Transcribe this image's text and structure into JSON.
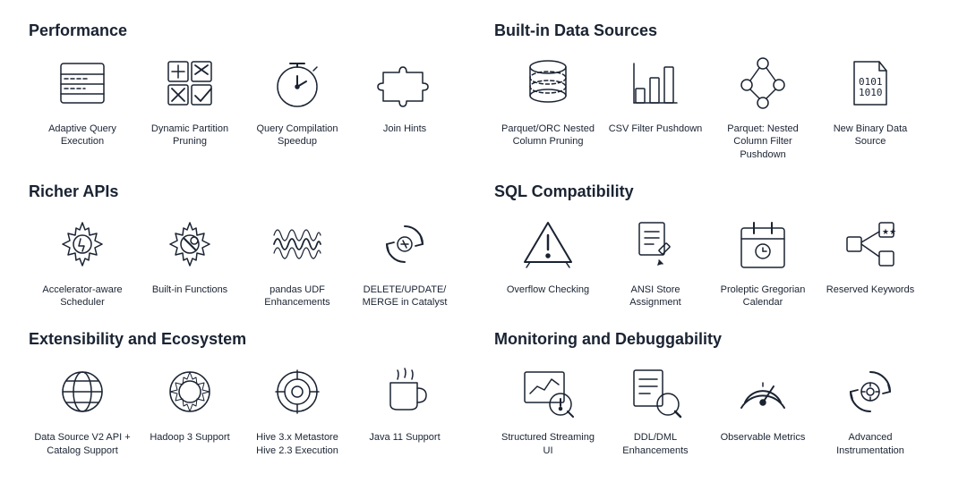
{
  "sections": [
    {
      "id": "performance",
      "title": "Performance",
      "items": [
        {
          "id": "adaptive-query",
          "label": "Adaptive Query Execution",
          "icon": "adaptive-query"
        },
        {
          "id": "dynamic-partition",
          "label": "Dynamic Partition Pruning",
          "icon": "dynamic-partition"
        },
        {
          "id": "query-compilation",
          "label": "Query Compilation Speedup",
          "icon": "query-compilation"
        },
        {
          "id": "join-hints",
          "label": "Join Hints",
          "icon": "join-hints"
        }
      ]
    },
    {
      "id": "built-in-sources",
      "title": "Built-in Data Sources",
      "items": [
        {
          "id": "parquet-orc-nested",
          "label": "Parquet/ORC Nested Column Pruning",
          "icon": "parquet-orc"
        },
        {
          "id": "csv-filter",
          "label": "CSV Filter Pushdown",
          "icon": "csv-filter"
        },
        {
          "id": "parquet-nested-filter",
          "label": "Parquet: Nested Column Filter Pushdown",
          "icon": "parquet-nested-filter"
        },
        {
          "id": "new-binary",
          "label": "New Binary Data Source",
          "icon": "new-binary"
        }
      ]
    },
    {
      "id": "richer-apis",
      "title": "Richer APIs",
      "items": [
        {
          "id": "accelerator-aware",
          "label": "Accelerator-aware Scheduler",
          "icon": "accelerator"
        },
        {
          "id": "built-in-functions",
          "label": "Built-in Functions",
          "icon": "built-in-functions"
        },
        {
          "id": "pandas-udf",
          "label": "pandas UDF Enhancements",
          "icon": "pandas-udf"
        },
        {
          "id": "delete-update",
          "label": "DELETE/UPDATE/ MERGE in Catalyst",
          "icon": "delete-update"
        }
      ]
    },
    {
      "id": "sql-compatibility",
      "title": "SQL Compatibility",
      "items": [
        {
          "id": "overflow-checking",
          "label": "Overflow Checking",
          "icon": "overflow"
        },
        {
          "id": "ansi-store",
          "label": "ANSI Store Assignment",
          "icon": "ansi-store"
        },
        {
          "id": "proleptic",
          "label": "Proleptic Gregorian Calendar",
          "icon": "proleptic"
        },
        {
          "id": "reserved-keywords",
          "label": "Reserved Keywords",
          "icon": "reserved-keywords"
        }
      ]
    },
    {
      "id": "extensibility",
      "title": "Extensibility and Ecosystem",
      "items": [
        {
          "id": "datasource-v2",
          "label": "Data Source V2 API + Catalog Support",
          "icon": "datasource-v2"
        },
        {
          "id": "hadoop3",
          "label": "Hadoop 3 Support",
          "icon": "hadoop3"
        },
        {
          "id": "hive3x",
          "label": "Hive 3.x Metastore Hive 2.3 Execution",
          "icon": "hive3x"
        },
        {
          "id": "java11",
          "label": "Java 11 Support",
          "icon": "java11"
        }
      ]
    },
    {
      "id": "monitoring",
      "title": "Monitoring and Debuggability",
      "items": [
        {
          "id": "structured-streaming",
          "label": "Structured Streaming UI",
          "icon": "structured-streaming"
        },
        {
          "id": "ddl-dml",
          "label": "DDL/DML Enhancements",
          "icon": "ddl-dml"
        },
        {
          "id": "observable",
          "label": "Observable Metrics",
          "icon": "observable"
        },
        {
          "id": "advanced-instrumentation",
          "label": "Advanced Instrumentation",
          "icon": "advanced-instrumentation"
        }
      ]
    }
  ]
}
